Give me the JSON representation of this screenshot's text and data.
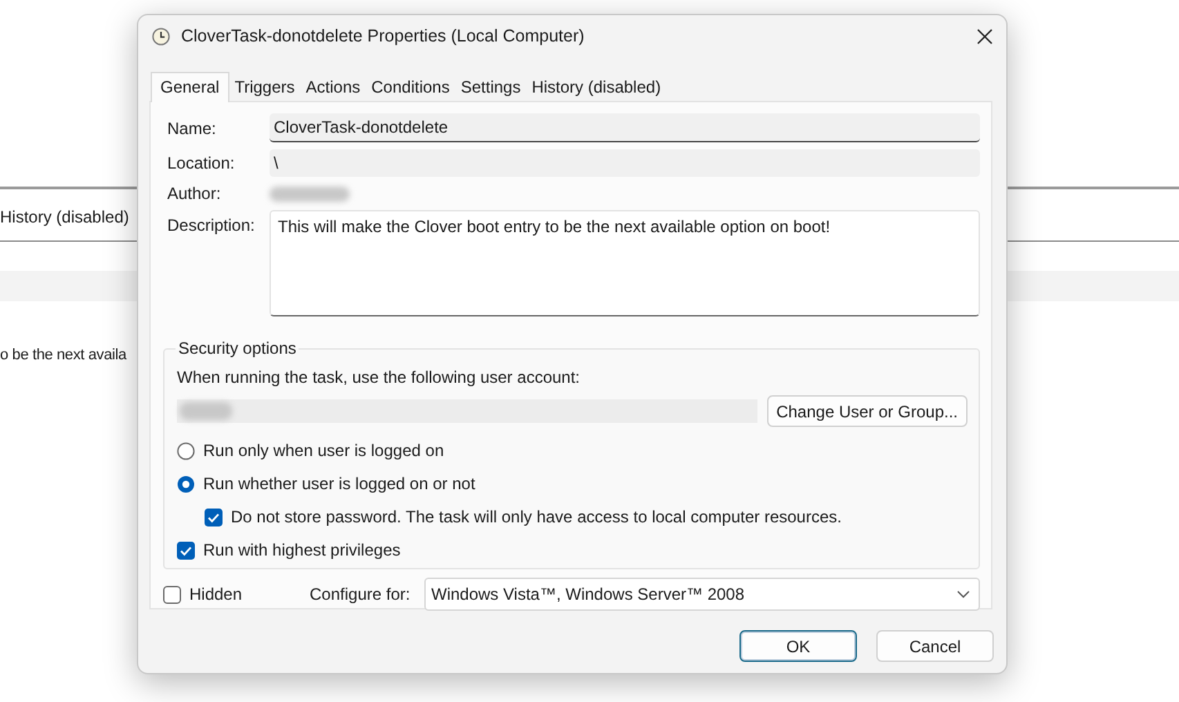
{
  "background": {
    "tab_label": "History (disabled)",
    "description_fragment": "o be the next availa"
  },
  "dialog": {
    "title": "CloverTask-donotdelete Properties (Local Computer)",
    "tabs": [
      {
        "label": "General",
        "selected": true
      },
      {
        "label": "Triggers",
        "selected": false
      },
      {
        "label": "Actions",
        "selected": false
      },
      {
        "label": "Conditions",
        "selected": false
      },
      {
        "label": "Settings",
        "selected": false
      },
      {
        "label": "History (disabled)",
        "selected": false
      }
    ],
    "general": {
      "name_label": "Name:",
      "name": "CloverTask-donotdelete",
      "location_label": "Location:",
      "location": "\\",
      "author_label": "Author:",
      "description_label": "Description:",
      "description": "This will make the Clover boot entry to be the next available option on boot!"
    },
    "security": {
      "title": "Security options",
      "account_prompt": "When running the task, use the following user account:",
      "change_button": "Change User or Group...",
      "options": [
        {
          "kind": "radio",
          "label": "Run only when user is logged on",
          "selected": false
        },
        {
          "kind": "radio",
          "label": "Run whether user is logged on or not",
          "selected": true,
          "children": [
            {
              "kind": "checkbox",
              "label": "Do not store password.  The task will only have access to local computer resources.",
              "checked": true
            }
          ]
        },
        {
          "kind": "checkbox",
          "label": "Run with highest privileges",
          "checked": true
        }
      ]
    },
    "hidden": {
      "label": "Hidden",
      "checked": false
    },
    "configure": {
      "label": "Configure for:",
      "value": "Windows Vista™, Windows Server™ 2008"
    },
    "buttons": [
      {
        "label": "OK",
        "default": true
      },
      {
        "label": "Cancel",
        "default": false
      }
    ]
  }
}
